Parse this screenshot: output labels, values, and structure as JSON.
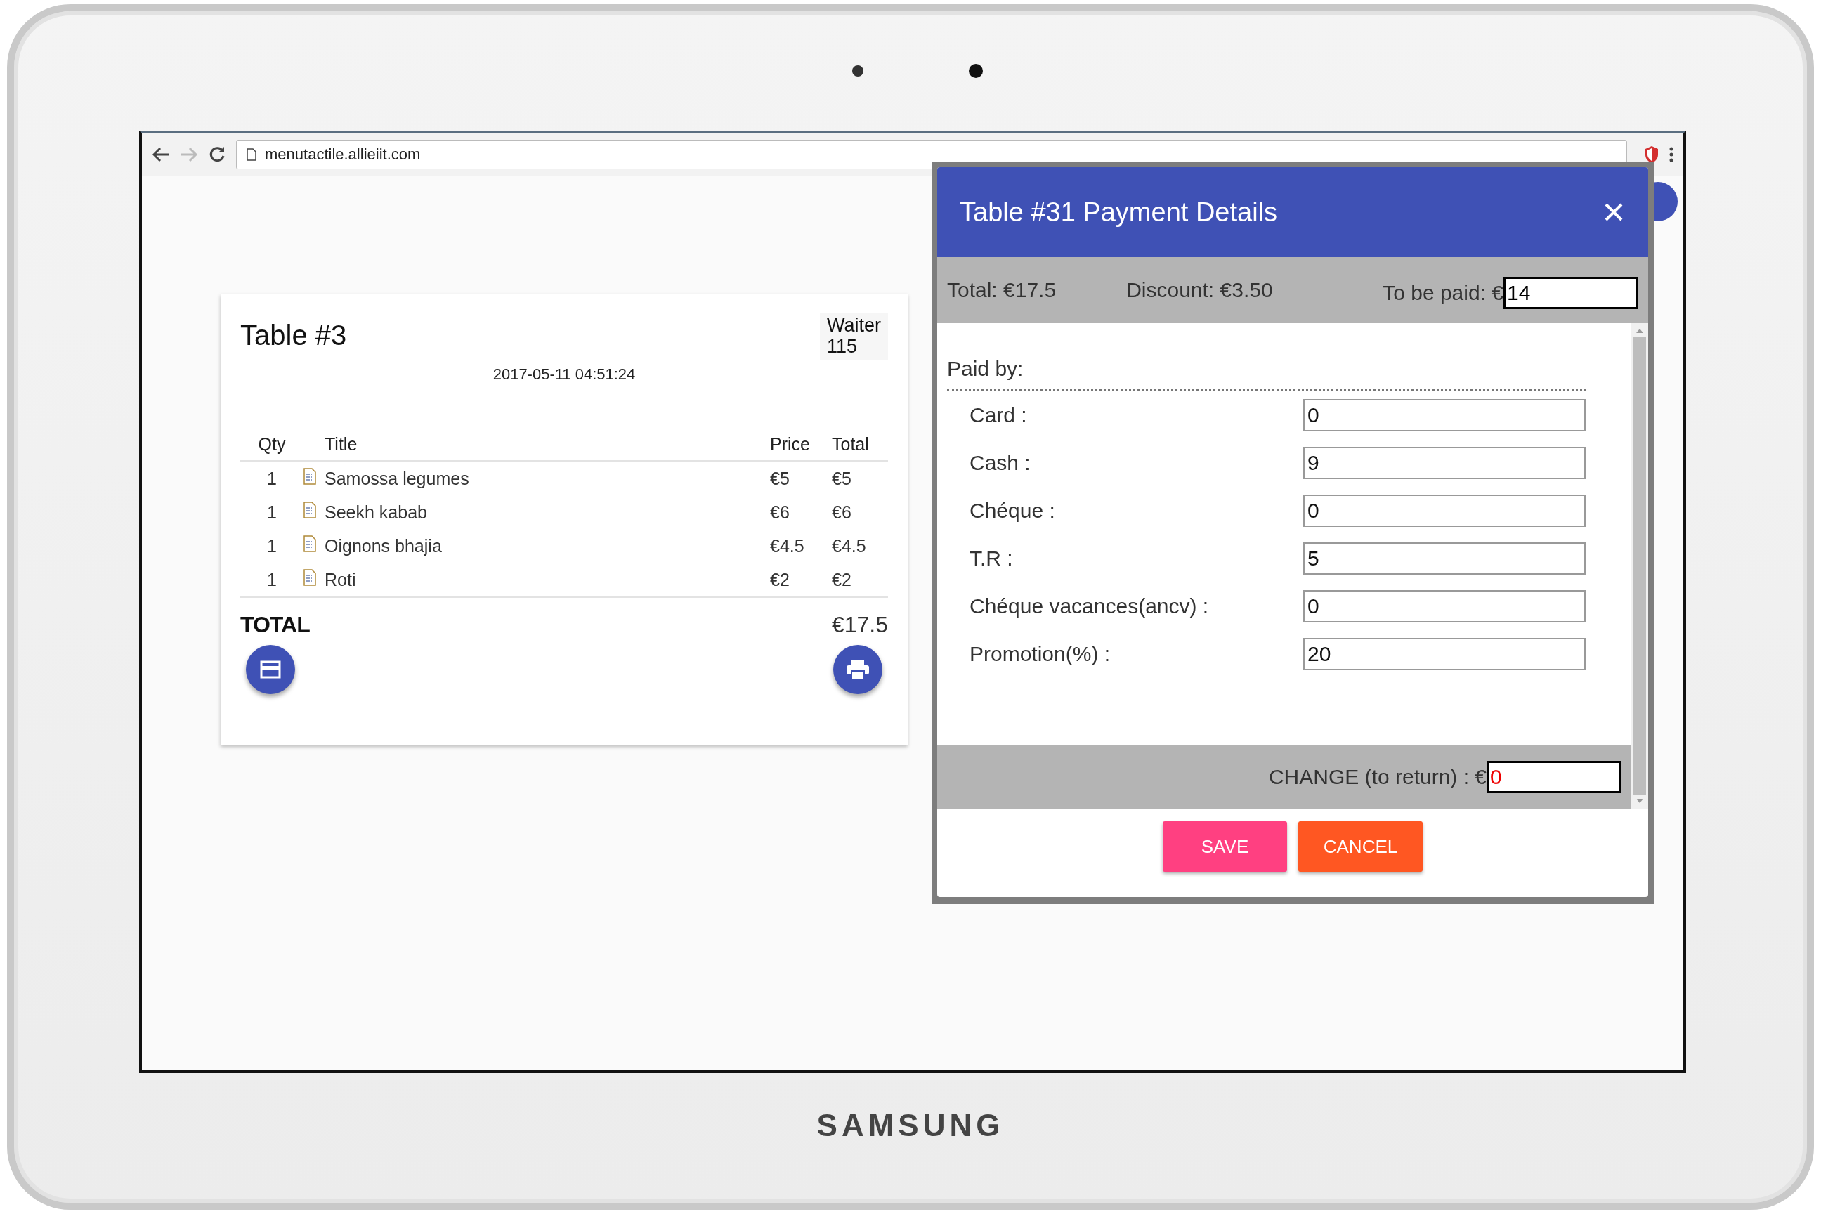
{
  "device": {
    "brand": "SAMSUNG"
  },
  "browser": {
    "url": "menutactile.allieiit.com"
  },
  "receipt": {
    "title": "Table #3",
    "waiter_label": "Waiter",
    "waiter_number": "115",
    "datetime": "2017-05-11 04:51:24",
    "columns": [
      "Qty",
      "Title",
      "Price",
      "Total"
    ],
    "rows": [
      {
        "qty": "1",
        "title": "Samossa legumes",
        "price": "€5",
        "total": "€5"
      },
      {
        "qty": "1",
        "title": "Seekh kabab",
        "price": "€6",
        "total": "€6"
      },
      {
        "qty": "1",
        "title": "Oignons bhajia",
        "price": "€4.5",
        "total": "€4.5"
      },
      {
        "qty": "1",
        "title": "Roti",
        "price": "€2",
        "total": "€2"
      }
    ],
    "total_label": "TOTAL",
    "total_value": "€17.5"
  },
  "dialog": {
    "title": "Table #31 Payment Details",
    "total": "Total: €17.5",
    "discount": "Discount: €3.50",
    "to_be_paid_label": "To be paid: €",
    "to_be_paid_value": "14",
    "paid_by": "Paid by:",
    "methods": [
      {
        "label": "Card :",
        "value": "0"
      },
      {
        "label": "Cash :",
        "value": "9"
      },
      {
        "label": "Chéque :",
        "value": "0"
      },
      {
        "label": "T.R :",
        "value": "5"
      },
      {
        "label": "Chéque vacances(ancv) :",
        "value": "0"
      },
      {
        "label": "Promotion(%) :",
        "value": "20"
      }
    ],
    "change_label": "CHANGE (to return) : €",
    "change_value": "0",
    "buttons": [
      {
        "label": "SAVE",
        "kind": "save"
      },
      {
        "label": "CANCEL",
        "kind": "cancel"
      }
    ]
  }
}
